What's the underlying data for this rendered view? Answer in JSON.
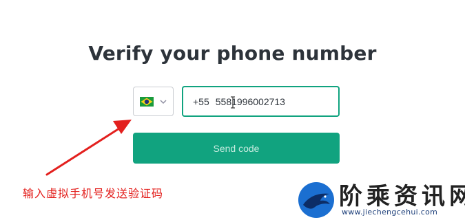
{
  "page": {
    "title": "Verify your phone number"
  },
  "phone_form": {
    "country": {
      "flag_icon": "brazil-flag-icon",
      "dropdown_icon": "chevron-down-icon"
    },
    "phone_input": {
      "country_code": "+55",
      "value": "5581996002713"
    },
    "send_button_label": "Send code"
  },
  "annotation": {
    "text": "输入虚拟手机号发送验证码",
    "color": "#e3201e"
  },
  "watermark": {
    "title": "阶乘资讯网",
    "url": "www.jiechengcehui.com"
  },
  "colors": {
    "accent": "#10a37f",
    "button_text": "#c7ece0"
  }
}
